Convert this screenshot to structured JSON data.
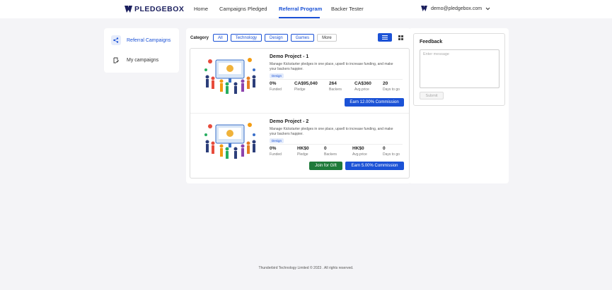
{
  "brand": {
    "name": "PLEDGEBOX",
    "accent": "#1b52d6",
    "dark": "#1b1f5e"
  },
  "nav": {
    "items": [
      {
        "label": "Home",
        "active": false
      },
      {
        "label": "Campaigns Pledged",
        "active": false
      },
      {
        "label": "Referral Program",
        "active": true
      },
      {
        "label": "Backer Tester",
        "active": false
      }
    ]
  },
  "account": {
    "email": "demo@pledgebox.com",
    "icon": "pledgebox-logo-icon",
    "caret": "chevron-down-icon"
  },
  "sidebar": {
    "items": [
      {
        "label": "Referral Campaigns",
        "icon": "share-icon",
        "active": true
      },
      {
        "label": "My campaigns",
        "icon": "campaign-edit-icon",
        "active": false
      }
    ]
  },
  "filters": {
    "label": "Category",
    "categories": [
      "All",
      "Technology",
      "Design",
      "Games"
    ],
    "more_label": "More"
  },
  "view": {
    "list_icon": "list-view-icon",
    "grid_icon": "grid-view-icon",
    "active": "list"
  },
  "projects": [
    {
      "title": "Demo Project - 1",
      "description": "Manage Kickstarter pledges in one place, upsell to increase funding, and make your backers happier.",
      "tag": "Design",
      "stats": [
        {
          "value": "0%",
          "label": "Funded"
        },
        {
          "value": "CA$95,040",
          "label": "Pledge"
        },
        {
          "value": "264",
          "label": "Backers"
        },
        {
          "value": "CA$360",
          "label": "Avg.price"
        },
        {
          "value": "20",
          "label": "Days to go"
        }
      ],
      "commission_label": "Earn 12.00% Commission"
    },
    {
      "title": "Demo Project - 2",
      "description": "Manage Kickstarter pledges in one place, upsell to increase funding, and make your backers happier.",
      "tag": "Design",
      "stats": [
        {
          "value": "0%",
          "label": "Funded"
        },
        {
          "value": "HK$0",
          "label": "Pledge"
        },
        {
          "value": "0",
          "label": "Backers"
        },
        {
          "value": "HK$0",
          "label": "Avg.price"
        },
        {
          "value": "0",
          "label": "Days to go"
        }
      ],
      "gift_label": "Join for Gift",
      "commission_label": "Earn 5.00% Commission"
    }
  ],
  "feedback": {
    "title": "Feedback",
    "placeholder": "Enter message",
    "submit_label": "Submit"
  },
  "footer": {
    "text": "Thunderbird Technology Limited © 2023 . All rights reserved."
  }
}
